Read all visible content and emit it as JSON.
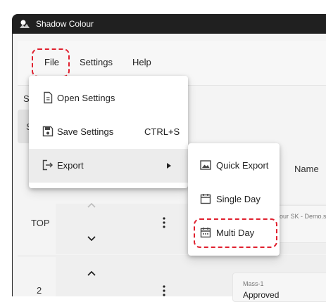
{
  "window": {
    "title": "Shadow Colour"
  },
  "menubar": {
    "items": [
      "File",
      "Settings",
      "Help"
    ]
  },
  "file_menu": {
    "items": [
      {
        "label": "Open Settings",
        "icon": "file-icon",
        "shortcut": ""
      },
      {
        "label": "Save Settings",
        "icon": "save-icon",
        "shortcut": "CTRL+S"
      },
      {
        "label": "Export",
        "icon": "export-icon",
        "shortcut": "",
        "has_submenu": true
      }
    ]
  },
  "export_submenu": {
    "items": [
      {
        "label": "Quick Export",
        "icon": "image-icon"
      },
      {
        "label": "Single Day",
        "icon": "calendar-icon"
      },
      {
        "label": "Multi Day",
        "icon": "calendar-range-icon"
      }
    ]
  },
  "background": {
    "s1": "S",
    "s2": "S",
    "name_header": "Name",
    "row1_label": "TOP",
    "row2_label": "2",
    "card1_text": "our SK - Demo.s",
    "card2_small": "Mass-1",
    "card2_status": "Approved"
  },
  "colors": {
    "highlight": "#e0202e",
    "titlebar": "#202020"
  }
}
